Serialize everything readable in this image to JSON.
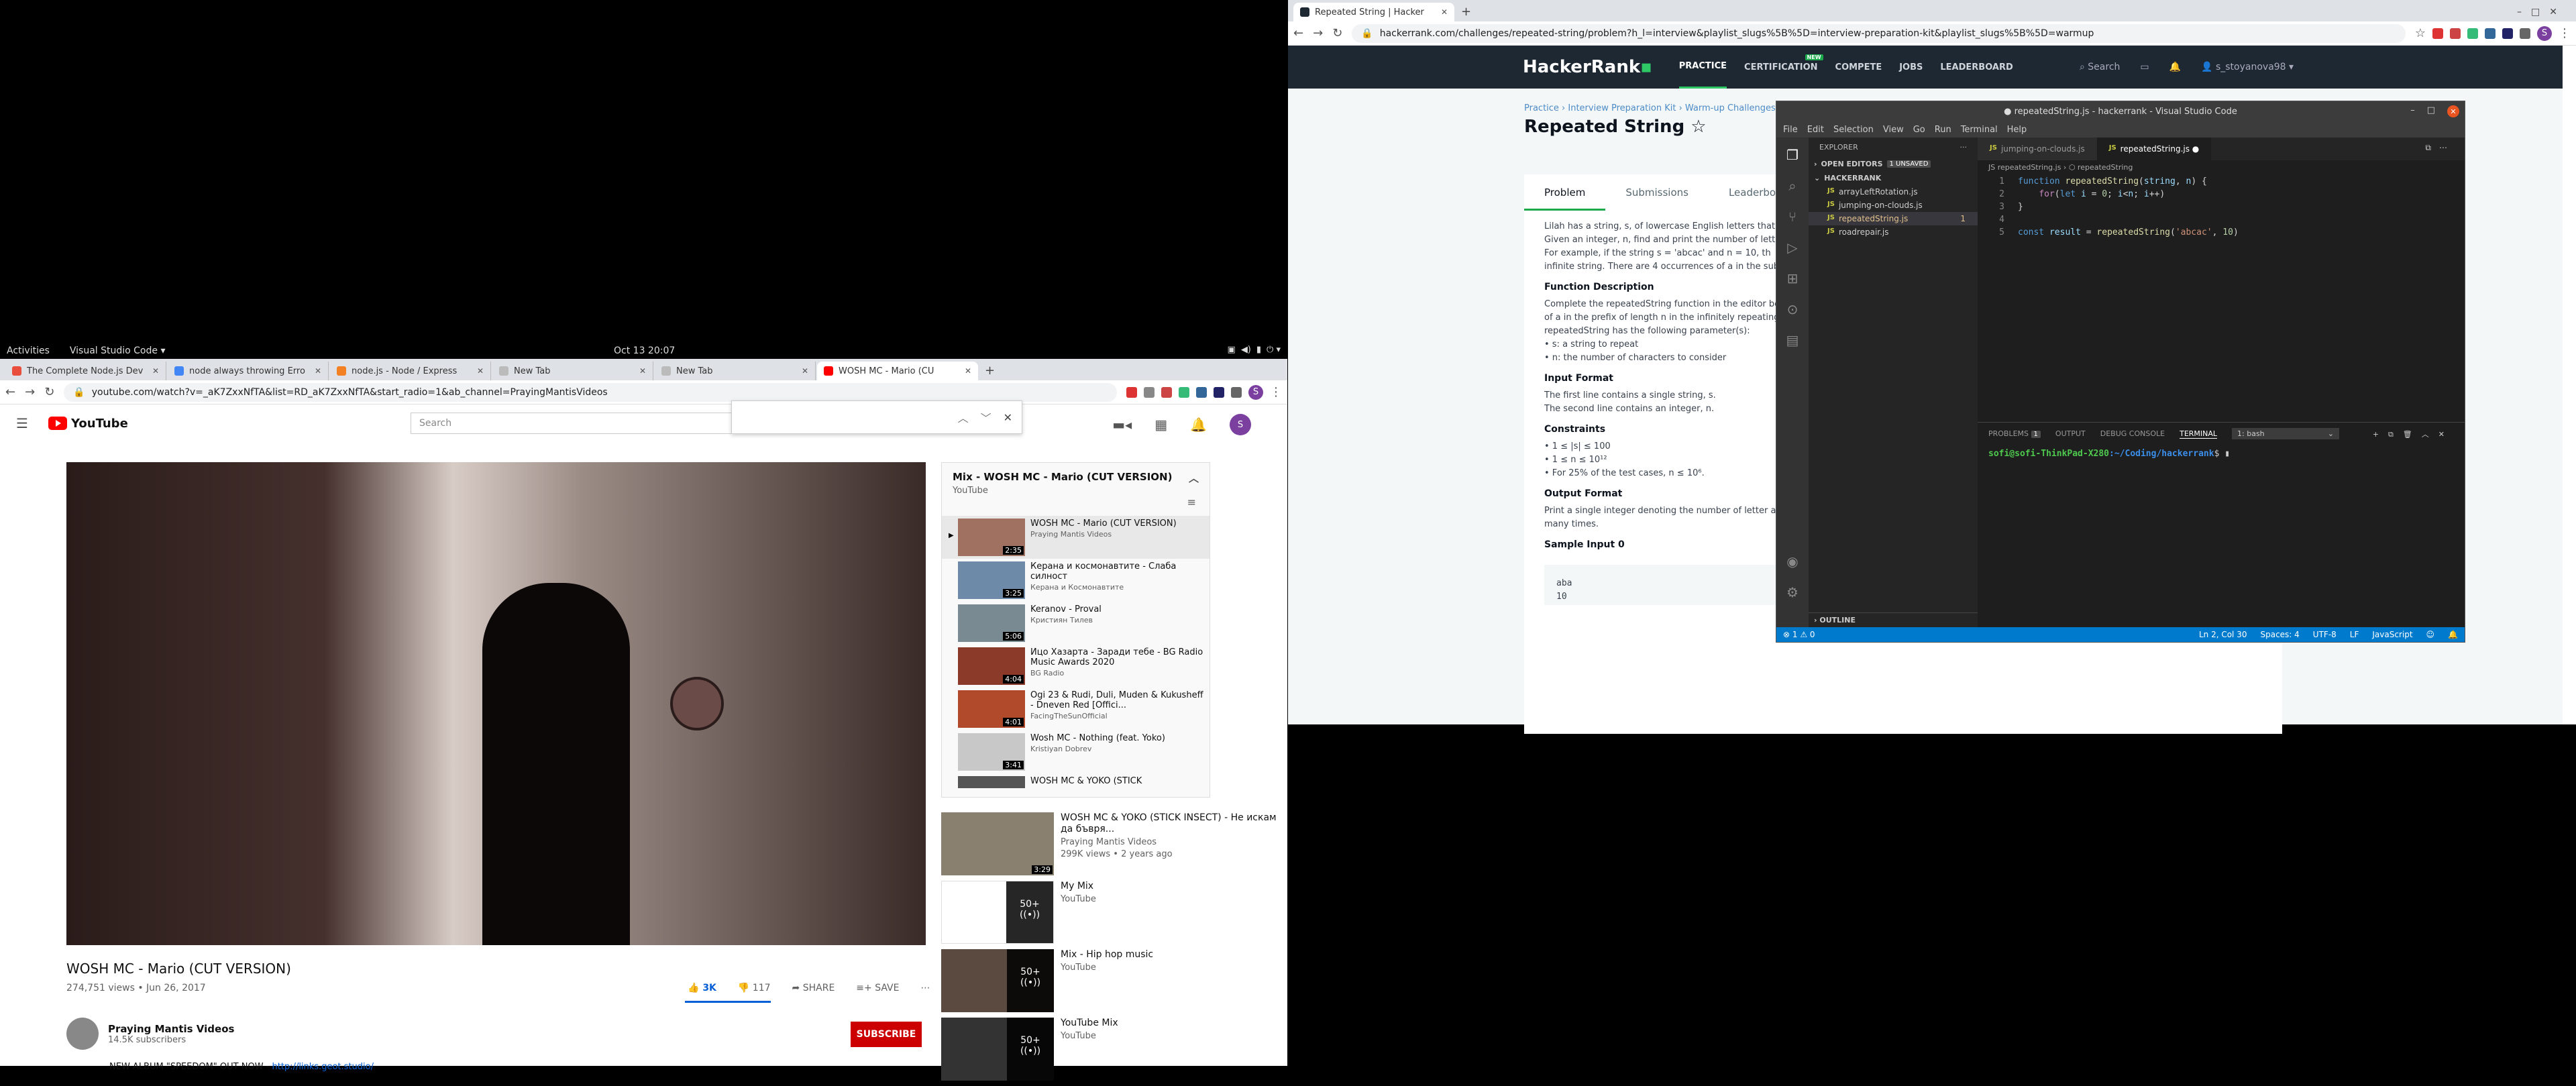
{
  "topbar": {
    "activities": "Activities",
    "app": "Visual Studio Code ▾",
    "clock": "Oct 13  20:07"
  },
  "left_browser": {
    "tabs": [
      {
        "title": "The Complete Node.js Dev",
        "color": "#e94e3c"
      },
      {
        "title": "node always throwing Erro",
        "color": "#4285f4"
      },
      {
        "title": "node.js - Node / Express",
        "color": "#f48024"
      },
      {
        "title": "New Tab",
        "color": "#bbbbbb"
      },
      {
        "title": "New Tab",
        "color": "#bbbbbb"
      },
      {
        "title": "WOSH MC - Mario (CU",
        "color": "#ff0000"
      }
    ],
    "url": "youtube.com/watch?v=_aK7ZxxNfTA&list=RD_aK7ZxxNfTA&start_radio=1&ab_channel=PrayingMantisVideos",
    "avatar": "S"
  },
  "youtube": {
    "logo": "YouTube",
    "search_placeholder": "Search",
    "video_title": "WOSH MC - Mario (CUT VERSION)",
    "views": "274,751 views • Jun 26, 2017",
    "likes": "3K",
    "dislikes": "117",
    "share": "SHARE",
    "save": "SAVE",
    "channel": "Praying Mantis Videos",
    "subs": "14.5K subscribers",
    "subscribe": "SUBSCRIBE",
    "desc_prefix": "NEW ALBUM \"SPEEDOM\" OUT NOW - ",
    "desc_link": "http://links.geot.studio/",
    "playlist": {
      "title": "Mix - WOSH MC - Mario (CUT VERSION)",
      "sub": "YouTube",
      "items": [
        {
          "title": "WOSH MC - Mario (CUT VERSION)",
          "artist": "Praying Mantis Videos",
          "dur": "2:35"
        },
        {
          "title": "Керана и космонавтите - Слаба силност",
          "artist": "Керана и Космонавтите",
          "dur": "3:25"
        },
        {
          "title": "Keranov - Proval",
          "artist": "Кристиян Тилев",
          "dur": "5:06"
        },
        {
          "title": "Ицо Хазарта - Заради тебе - BG Radio Music Awards 2020",
          "artist": "BG Radio",
          "dur": "4:04"
        },
        {
          "title": "Ogi 23 & Rudi, Duli, Muden & Kukusheff - Dneven Red [Offici...",
          "artist": "FacingTheSunOfficial",
          "dur": "4:01"
        },
        {
          "title": "Wosh MC - Nothing (feat. Yoko)",
          "artist": "Kristiyan Dobrev",
          "dur": "3:41"
        },
        {
          "title": "WOSH MC & YOKO (STICK",
          "artist": "",
          "dur": ""
        }
      ]
    },
    "recs": [
      {
        "title": "WOSH MC & YOKO (STICK INSECT) - Не искам да бъвря...",
        "artist": "Praying Mantis Videos",
        "meta": "299K views • 2 years ago",
        "badge": "3:29"
      },
      {
        "title": "My Mix",
        "artist": "YouTube",
        "meta": "",
        "badge": "50+"
      },
      {
        "title": "Mix - Hip hop music",
        "artist": "YouTube",
        "meta": "",
        "badge": "50+"
      },
      {
        "title": "YouTube Mix",
        "artist": "YouTube",
        "meta": "",
        "badge": "50+"
      }
    ]
  },
  "right_browser": {
    "tab": "Repeated String | Hacker",
    "url": "hackerrank.com/challenges/repeated-string/problem?h_l=interview&playlist_slugs%5B%5D=interview-preparation-kit&playlist_slugs%5B%5D=warmup",
    "avatar": "S"
  },
  "hackerrank": {
    "logo": "HackerRank",
    "nav": [
      "PRACTICE",
      "CERTIFICATION",
      "COMPETE",
      "JOBS",
      "LEADERBOARD"
    ],
    "new_badge": "NEW",
    "search": "Search",
    "user": "s_stoyanova98",
    "crumb": "Practice  ›  Interview Preparation Kit  ›  Warm-up Challenges",
    "title": "Repeated String ☆",
    "tabs": [
      "Problem",
      "Submissions",
      "Leaderboard"
    ],
    "p1": "Lilah has a string, s, of lowercase English letters that",
    "p2": "Given an integer, n, find and print the number of lett",
    "p3": "For example, if the string s = 'abcac' and n = 10, th",
    "p4": "infinite string. There are 4 occurrences of a in the sub",
    "h_fd": "Function Description",
    "p5": "Complete the repeatedString function in the editor be",
    "p6": "of a in the prefix of length n in the infinitely repeating",
    "p7": "repeatedString has the following parameter(s):",
    "b1": "• s: a string to repeat",
    "b2": "• n: the number of characters to consider",
    "h_if": "Input Format",
    "p8": "The first line contains a single string, s.",
    "p9": "The second line contains an integer, n.",
    "h_c": "Constraints",
    "c1": "• 1 ≤ |s| ≤ 100",
    "c2": "• 1 ≤ n ≤ 10¹²",
    "c3": "• For 25% of the test cases, n ≤ 10⁶.",
    "h_of": "Output Format",
    "p10": "Print a single integer denoting the number of letter a",
    "p11": "many times.",
    "h_s0": "Sample Input 0",
    "sample1": "aba",
    "sample2": "10"
  },
  "vscode": {
    "title": "● repeatedString.js - hackerrank - Visual Studio Code",
    "menu": [
      "File",
      "Edit",
      "Selection",
      "View",
      "Go",
      "Run",
      "Terminal",
      "Help"
    ],
    "explorer": "EXPLORER",
    "open_editors": "OPEN EDITORS",
    "unsaved": "1 UNSAVED",
    "folder": "HACKERRANK",
    "files": [
      "arrayLeftRotation.js",
      "jumping-on-clouds.js",
      "repeatedString.js",
      "roadrepair.js"
    ],
    "outline": "OUTLINE",
    "tabs": [
      "jumping-on-clouds.js",
      "repeatedString.js ●"
    ],
    "crumb": "JS repeatedString.js › ⬡ repeatedString",
    "panel_tabs": [
      "PROBLEMS",
      "OUTPUT",
      "DEBUG CONSOLE",
      "TERMINAL"
    ],
    "problems_count": "1",
    "shell": "1: bash",
    "prompt_user": "sofi@sofi-ThinkPad-X280",
    "prompt_path": ":~/Coding/hackerrank",
    "status_left": "⊗ 1 ⚠ 0",
    "status_right": [
      "Ln 2, Col 30",
      "Spaces: 4",
      "UTF-8",
      "LF",
      "JavaScript"
    ]
  }
}
